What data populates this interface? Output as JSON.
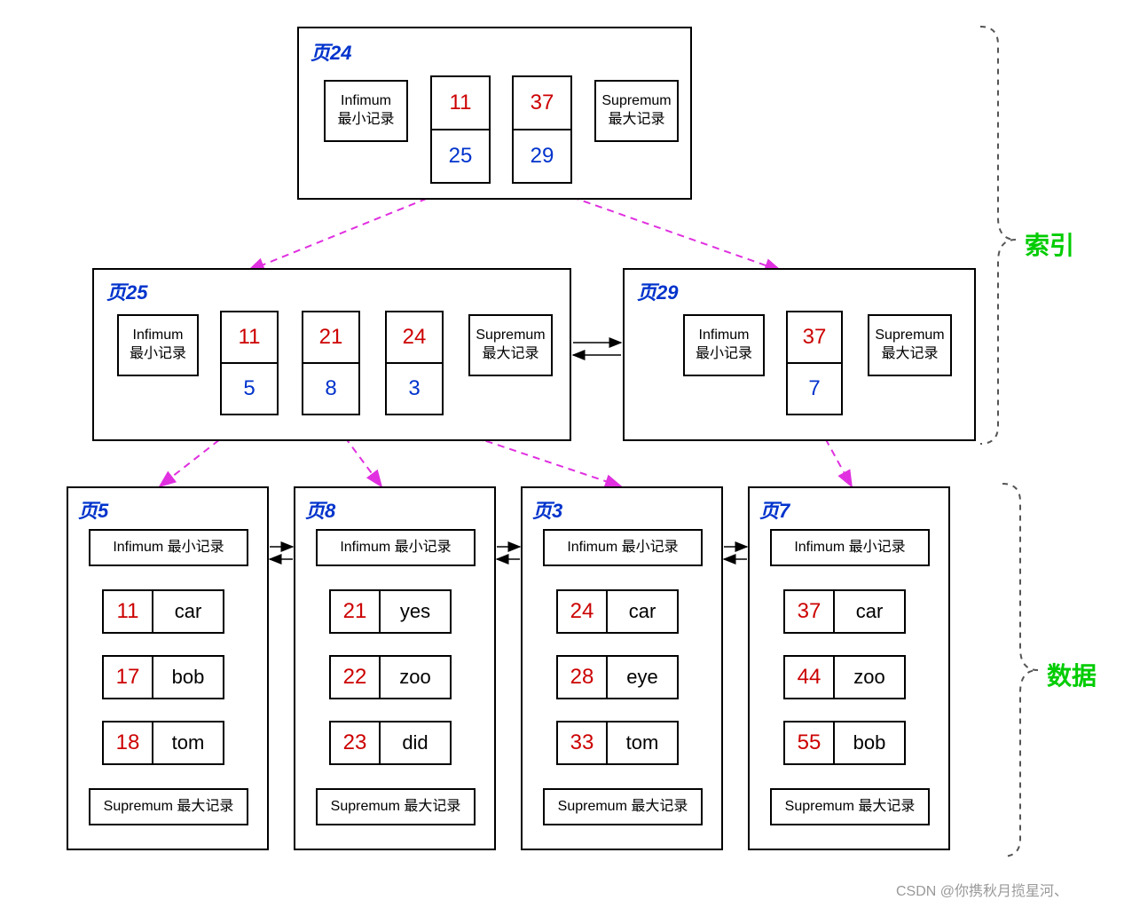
{
  "labels": {
    "infimum_line1": "Infimum",
    "infimum_line2": "最小记录",
    "supremum_line1": "Supremum",
    "supremum_line2": "最大记录",
    "infimum_full": "Infimum 最小记录",
    "supremum_full": "Supremum 最大记录",
    "index_label": "索引",
    "data_label": "数据",
    "watermark": "CSDN @你携秋月揽星河、"
  },
  "pages": {
    "p24": {
      "title": "页24",
      "entries": [
        {
          "key": "11",
          "ptr": "25"
        },
        {
          "key": "37",
          "ptr": "29"
        }
      ]
    },
    "p25": {
      "title": "页25",
      "entries": [
        {
          "key": "11",
          "ptr": "5"
        },
        {
          "key": "21",
          "ptr": "8"
        },
        {
          "key": "24",
          "ptr": "3"
        }
      ]
    },
    "p29": {
      "title": "页29",
      "entries": [
        {
          "key": "37",
          "ptr": "7"
        }
      ]
    },
    "leaf5": {
      "title": "页5",
      "rows": [
        {
          "k": "11",
          "v": "car"
        },
        {
          "k": "17",
          "v": "bob"
        },
        {
          "k": "18",
          "v": "tom"
        }
      ]
    },
    "leaf8": {
      "title": "页8",
      "rows": [
        {
          "k": "21",
          "v": "yes"
        },
        {
          "k": "22",
          "v": "zoo"
        },
        {
          "k": "23",
          "v": "did"
        }
      ]
    },
    "leaf3": {
      "title": "页3",
      "rows": [
        {
          "k": "24",
          "v": "car"
        },
        {
          "k": "28",
          "v": "eye"
        },
        {
          "k": "33",
          "v": "tom"
        }
      ]
    },
    "leaf7": {
      "title": "页7",
      "rows": [
        {
          "k": "37",
          "v": "car"
        },
        {
          "k": "44",
          "v": "zoo"
        },
        {
          "k": "55",
          "v": "bob"
        }
      ]
    }
  }
}
